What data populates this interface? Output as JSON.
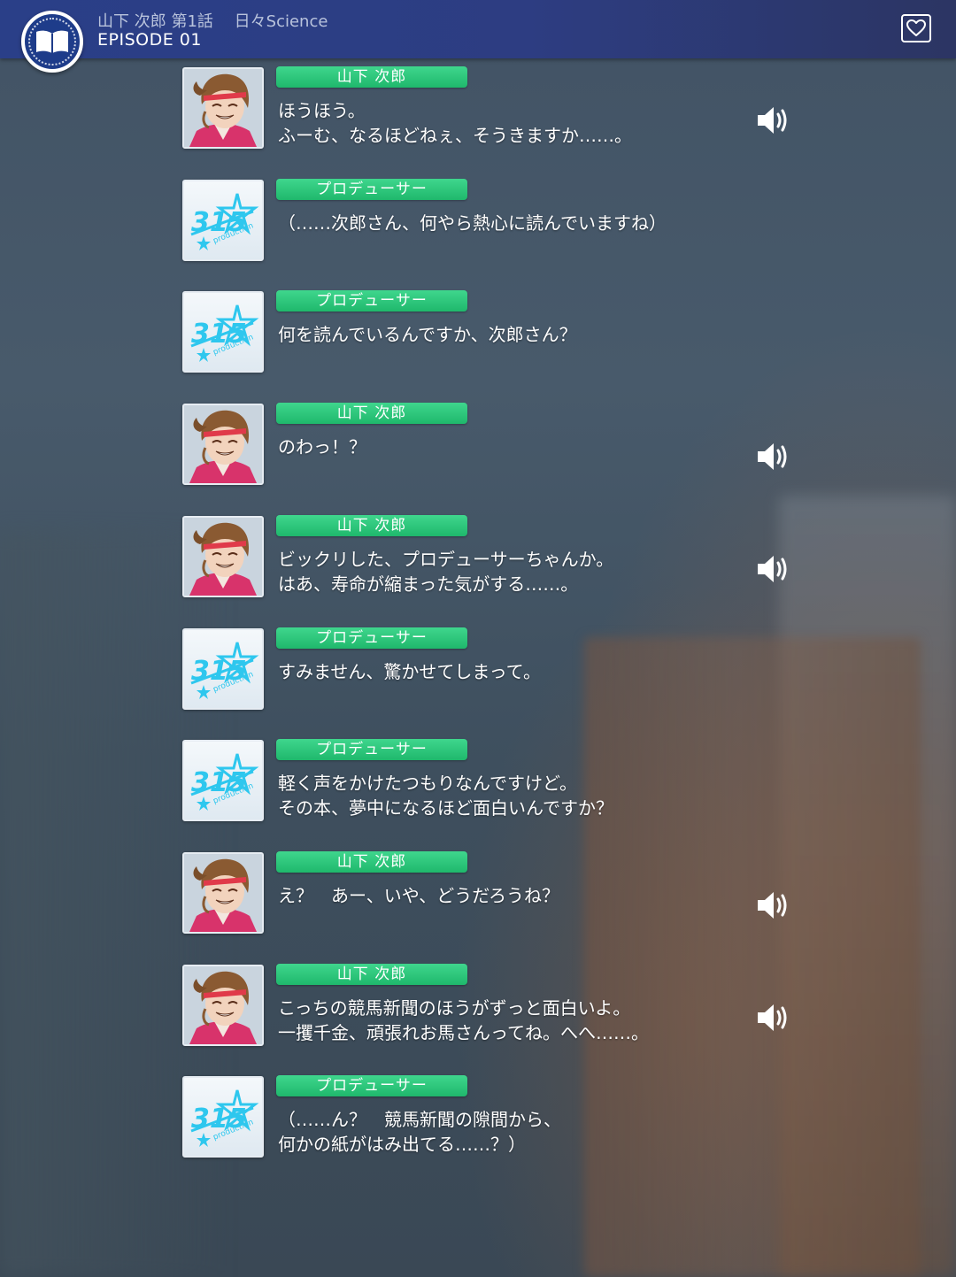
{
  "header": {
    "character": "山下 次郎",
    "chapter": "第1話",
    "story_title": "日々Science",
    "episode": "EPISODE 01",
    "icons": {
      "left": "book-icon",
      "right": "heart-icon"
    }
  },
  "speakers": {
    "jiro": "山下 次郎",
    "producer": "プロデューサー"
  },
  "colors": {
    "name_tag": "#25c07a",
    "header": "#2c3c84"
  },
  "messages": [
    {
      "speaker": "山下 次郎",
      "avatar": "jiro",
      "lines": [
        "ほうほう。",
        "ふーむ、なるほどねぇ、そうきますか……。"
      ],
      "voice": true
    },
    {
      "speaker": "プロデューサー",
      "avatar": "producer",
      "lines": [
        "（……次郎さん、何やら熱心に読んでいますね）"
      ],
      "voice": false
    },
    {
      "speaker": "プロデューサー",
      "avatar": "producer",
      "lines": [
        "何を読んでいるんですか、次郎さん？"
      ],
      "voice": false
    },
    {
      "speaker": "山下 次郎",
      "avatar": "jiro",
      "lines": [
        "のわっ！？"
      ],
      "voice": true
    },
    {
      "speaker": "山下 次郎",
      "avatar": "jiro",
      "lines": [
        "ビックリした、プロデューサーちゃんか。",
        "はあ、寿命が縮まった気がする……。"
      ],
      "voice": true
    },
    {
      "speaker": "プロデューサー",
      "avatar": "producer",
      "lines": [
        "すみません、驚かせてしまって。"
      ],
      "voice": false
    },
    {
      "speaker": "プロデューサー",
      "avatar": "producer",
      "lines": [
        "軽く声をかけたつもりなんですけど。",
        "その本、夢中になるほど面白いんですか？"
      ],
      "voice": false
    },
    {
      "speaker": "山下 次郎",
      "avatar": "jiro",
      "lines": [
        "え？　あー、いや、どうだろうね？"
      ],
      "voice": true
    },
    {
      "speaker": "山下 次郎",
      "avatar": "jiro",
      "lines": [
        "こっちの競馬新聞のほうがずっと面白いよ。",
        "一攫千金、頑張れお馬さんってね。へへ……。"
      ],
      "voice": true
    },
    {
      "speaker": "プロデューサー",
      "avatar": "producer",
      "lines": [
        "（……ん？　競馬新聞の隙間から、",
        "何かの紙がはみ出てる……？）"
      ],
      "voice": false
    }
  ]
}
